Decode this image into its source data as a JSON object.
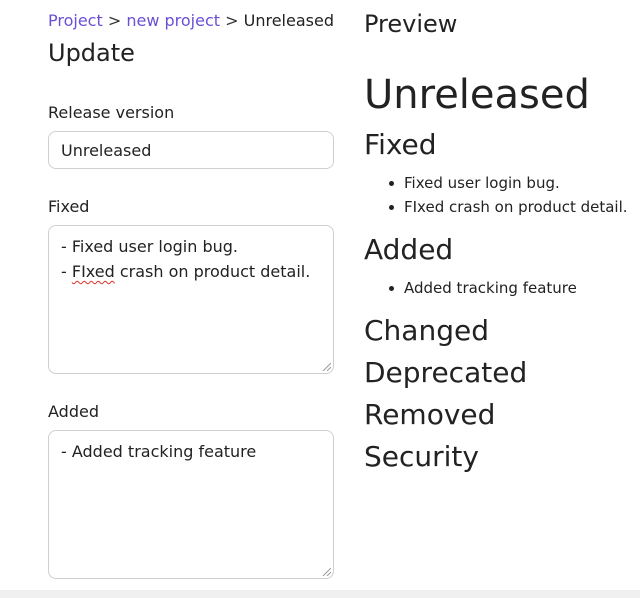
{
  "breadcrumb": {
    "items": [
      {
        "label": "Project",
        "link": true
      },
      {
        "label": "new project",
        "link": true
      },
      {
        "label": "Unreleased",
        "link": false
      }
    ],
    "separator": ">"
  },
  "form": {
    "title": "Update",
    "release_version": {
      "label": "Release version",
      "value": "Unreleased"
    },
    "fixed": {
      "label": "Fixed",
      "lines": [
        "- Fixed user login bug.",
        "- ",
        "FIxed",
        " crash on product detail."
      ]
    },
    "added": {
      "label": "Added",
      "lines": [
        "- Added tracking feature"
      ]
    }
  },
  "preview": {
    "heading": "Preview",
    "release": "Unreleased",
    "sections": {
      "fixed": {
        "title": "Fixed",
        "items": [
          "Fixed user login bug.",
          "FIxed crash on product detail."
        ]
      },
      "added": {
        "title": "Added",
        "items": [
          "Added tracking feature"
        ]
      },
      "changed": {
        "title": "Changed"
      },
      "deprecated": {
        "title": "Deprecated"
      },
      "removed": {
        "title": "Removed"
      },
      "security": {
        "title": "Security"
      }
    }
  },
  "colors": {
    "link": "#6c4fd6",
    "text": "#222222",
    "border": "#cfcfcf",
    "spellcheck": "#e0312b"
  }
}
